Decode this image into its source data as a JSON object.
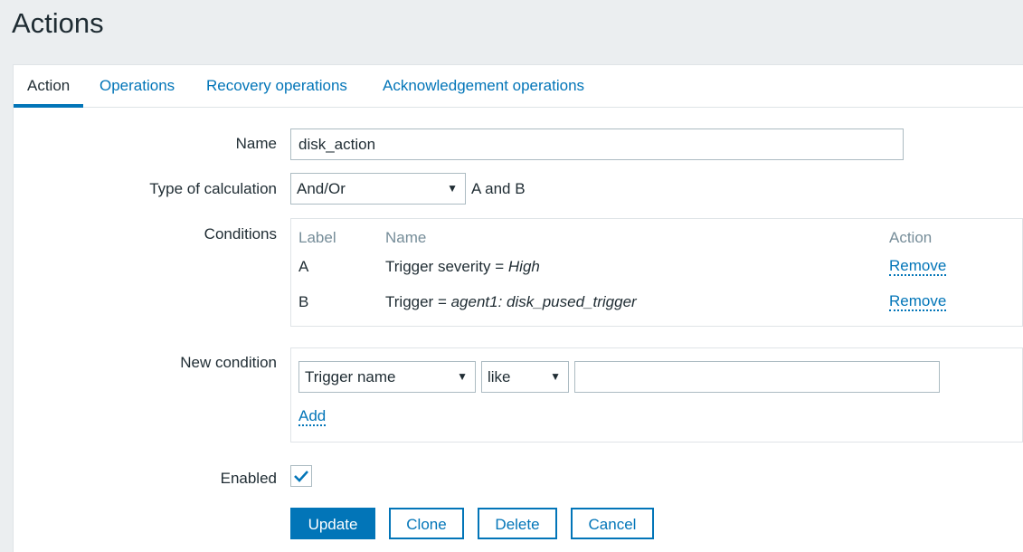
{
  "page": {
    "title": "Actions"
  },
  "tabs": [
    {
      "label": "Action",
      "active": true
    },
    {
      "label": "Operations"
    },
    {
      "label": "Recovery operations"
    },
    {
      "label": "Acknowledgement operations"
    }
  ],
  "form": {
    "name": {
      "label": "Name",
      "value": "disk_action"
    },
    "calculation": {
      "label": "Type of calculation",
      "selected": "And/Or",
      "formula": "A and B"
    },
    "conditions": {
      "label": "Conditions",
      "headers": {
        "label": "Label",
        "name": "Name",
        "action": "Action"
      },
      "rows": [
        {
          "label": "A",
          "name_prefix": "Trigger severity = ",
          "name_value": "High",
          "action": "Remove"
        },
        {
          "label": "B",
          "name_prefix": "Trigger = ",
          "name_value": "agent1: disk_pused_trigger",
          "action": "Remove"
        }
      ]
    },
    "new_condition": {
      "label": "New condition",
      "type_selected": "Trigger name",
      "operator_selected": "like",
      "value": "",
      "add_label": "Add"
    },
    "enabled": {
      "label": "Enabled",
      "checked": true
    }
  },
  "buttons": {
    "update": "Update",
    "clone": "Clone",
    "delete": "Delete",
    "cancel": "Cancel"
  },
  "colors": {
    "accent": "#0275b8",
    "text": "#1f2c33",
    "muted": "#768d99",
    "background": "#ebeef0"
  },
  "icons": {
    "dropdown": "triangle-down-icon",
    "check": "checkmark-icon"
  }
}
